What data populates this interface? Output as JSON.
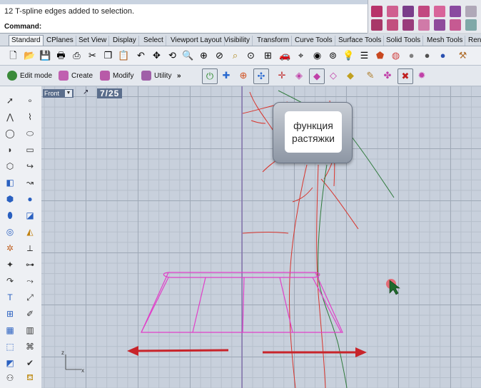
{
  "status": {
    "history_line": "12 T-spline edges added to selection."
  },
  "command": {
    "label": "Command:",
    "value": ""
  },
  "tabs": [
    {
      "label": "Standard",
      "active": true
    },
    {
      "label": "CPlanes"
    },
    {
      "label": "Set View"
    },
    {
      "label": "Display"
    },
    {
      "label": "Select"
    },
    {
      "label": "Viewport Layout"
    },
    {
      "label": "Visibility"
    },
    {
      "label": "Transform"
    },
    {
      "label": "Curve Tools"
    },
    {
      "label": "Surface Tools"
    },
    {
      "label": "Solid Tools"
    },
    {
      "label": "Mesh Tools"
    },
    {
      "label": "Ren"
    }
  ],
  "mode_bar": {
    "edit_mode": "Edit mode",
    "create": "Create",
    "modify": "Modify",
    "utility": "Utility",
    "more": "»"
  },
  "viewport": {
    "name": "Front",
    "counter": "7/25",
    "callout_text": "функция\nрастяжки",
    "axis_z": "z",
    "axis_x": "x"
  },
  "colors": {
    "curve_red": "#d8342c",
    "curve_green": "#2f7a3c",
    "selection_magenta": "#e040c8",
    "arrow_red": "#c8242a",
    "cplane_axis_purple": "#7a62a8"
  },
  "icons": {
    "std_toolbar": [
      "new-file-icon",
      "open-folder-icon",
      "save-icon",
      "print-icon",
      "import-icon",
      "cut-icon",
      "copy-icon",
      "paste-icon",
      "undo-icon",
      "pan-icon",
      "rotate-view-icon",
      "zoom-icon",
      "zoom-window-icon",
      "zoom-extents-icon",
      "zoom-selected-icon",
      "four-viewports-icon",
      "car-icon",
      "select-point-icon",
      "layer-icon",
      "light-bulb-icon",
      "properties-icon",
      "render-icon",
      "shaded-sphere-icon",
      "gloss-sphere-icon",
      "blue-sphere-icon",
      "options-icon"
    ],
    "mode_bar": [
      "power-icon",
      "gumball-axis-icon",
      "globe-icon",
      "manipulator-icon",
      "dotted-axis-icon",
      "t-spline-box-icon",
      "t-spline-solid-icon",
      "t-spline-smooth-icon",
      "t-spline-cube-icon",
      "t-spline-paint-icon",
      "t-spline-split-icon",
      "t-spline-close-icon",
      "t-spline-settings-icon"
    ]
  }
}
